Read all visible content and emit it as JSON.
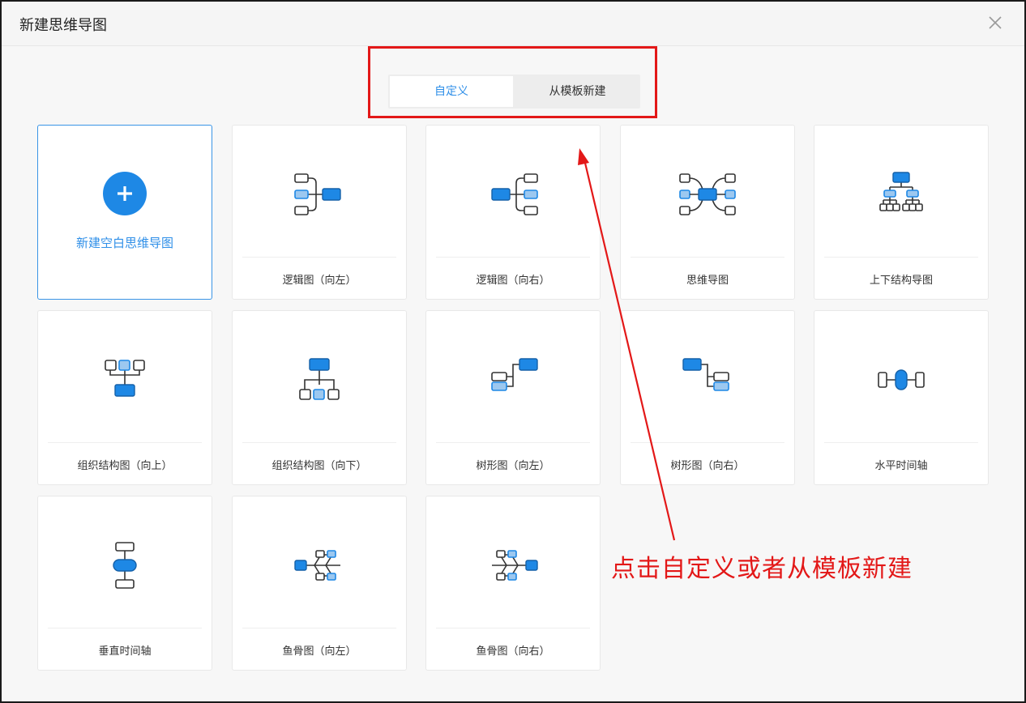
{
  "dialog": {
    "title": "新建思维导图",
    "close_icon": "close-icon"
  },
  "tabs": [
    {
      "label": "自定义",
      "active": true
    },
    {
      "label": "从模板新建",
      "active": false
    }
  ],
  "blank": {
    "label": "新建空白思维导图",
    "icon": "plus-icon"
  },
  "templates": [
    {
      "label": "逻辑图（向左）",
      "icon": "logic-left-icon"
    },
    {
      "label": "逻辑图（向右）",
      "icon": "logic-right-icon"
    },
    {
      "label": "思维导图",
      "icon": "mindmap-icon"
    },
    {
      "label": "上下结构导图",
      "icon": "top-down-icon"
    },
    {
      "label": "组织结构图（向上）",
      "icon": "org-up-icon"
    },
    {
      "label": "组织结构图（向下）",
      "icon": "org-down-icon"
    },
    {
      "label": "树形图（向左）",
      "icon": "tree-left-icon"
    },
    {
      "label": "树形图（向右）",
      "icon": "tree-right-icon"
    },
    {
      "label": "水平时间轴",
      "icon": "timeline-horizontal-icon"
    },
    {
      "label": "垂直时间轴",
      "icon": "timeline-vertical-icon"
    },
    {
      "label": "鱼骨图（向左）",
      "icon": "fishbone-left-icon"
    },
    {
      "label": "鱼骨图（向右）",
      "icon": "fishbone-right-icon"
    }
  ],
  "annotation": "点击自定义或者从模板新建",
  "colors": {
    "accent": "#1e88e5",
    "node_light": "#9cc8f0",
    "annotation": "#e31818"
  }
}
